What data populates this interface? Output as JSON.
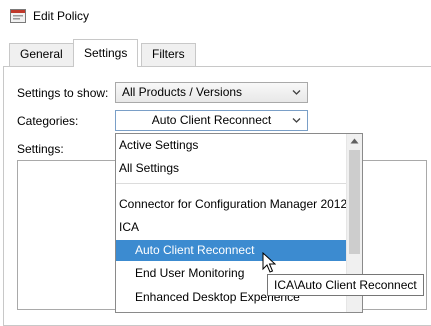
{
  "window": {
    "title": "Edit Policy",
    "icon": "policy-window-icon"
  },
  "tabs": [
    {
      "label": "General",
      "active": false
    },
    {
      "label": "Settings",
      "active": true
    },
    {
      "label": "Filters",
      "active": false
    }
  ],
  "form": {
    "settings_to_show_label": "Settings to show:",
    "settings_to_show_value": "All Products / Versions",
    "categories_label": "Categories:",
    "categories_value": "Auto Client Reconnect",
    "settings_label": "Settings:"
  },
  "dropdown": {
    "items": [
      {
        "label": "Active Settings",
        "level": 0,
        "selected": false
      },
      {
        "label": "All Settings",
        "level": 0,
        "selected": false
      },
      {
        "label": "Connector for Configuration Manager 2012",
        "level": 0,
        "selected": false
      },
      {
        "label": "ICA",
        "level": 0,
        "selected": false
      },
      {
        "label": "Auto Client Reconnect",
        "level": 1,
        "selected": true
      },
      {
        "label": "End User Monitoring",
        "level": 1,
        "selected": false
      },
      {
        "label": "Enhanced Desktop Experience",
        "level": 1,
        "selected": false
      }
    ]
  },
  "tooltip": {
    "text": "ICA\\Auto Client Reconnect"
  },
  "colors": {
    "selection": "#3c8bd0",
    "border": "#a9a9a9"
  }
}
